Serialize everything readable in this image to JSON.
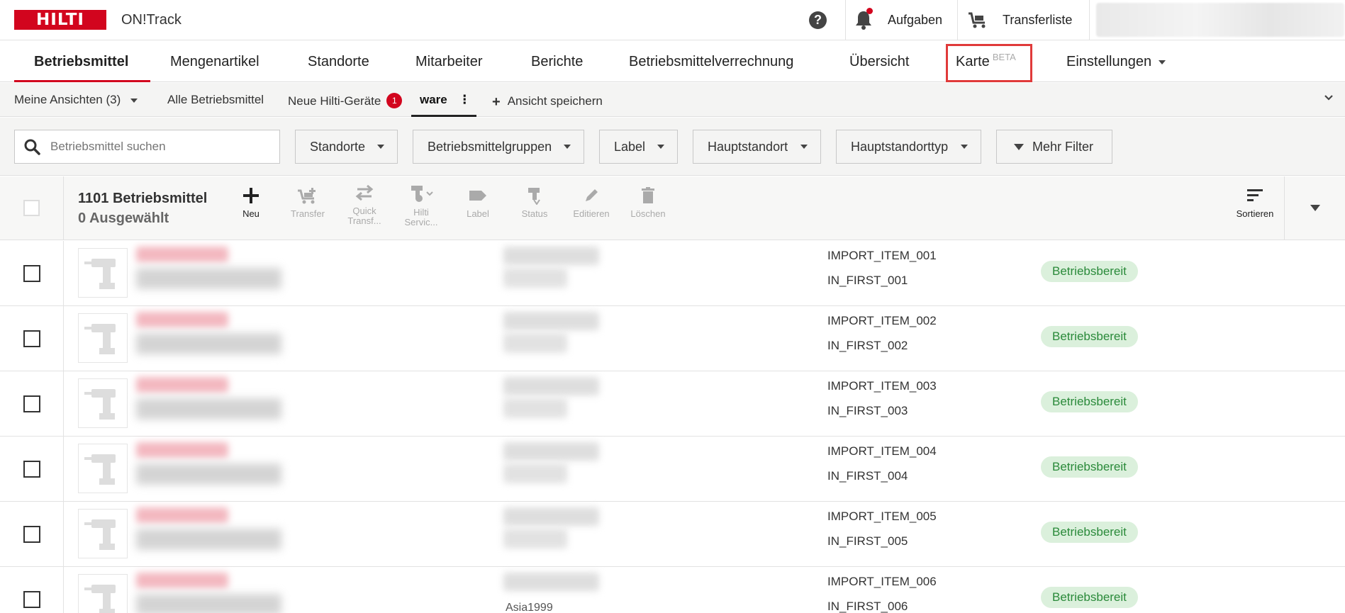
{
  "topbar": {
    "logo_text": "HILTI",
    "app_name": "ON!Track",
    "tasks_label": "Aufgaben",
    "transfer_label": "Transferliste"
  },
  "nav": {
    "items": [
      {
        "label": "Betriebsmittel"
      },
      {
        "label": "Mengenartikel"
      },
      {
        "label": "Standorte"
      },
      {
        "label": "Mitarbeiter"
      },
      {
        "label": "Berichte"
      },
      {
        "label": "Betriebsmittelverrechnung"
      },
      {
        "label": "Übersicht"
      },
      {
        "label": "Karte",
        "badge": "BETA"
      },
      {
        "label": "Einstellungen"
      }
    ]
  },
  "views": {
    "my_views": "Meine Ansichten (3)",
    "all": "Alle Betriebsmittel",
    "new_hilti": "Neue Hilti-Geräte",
    "new_hilti_count": "1",
    "current": "ware",
    "save_view": "Ansicht speichern"
  },
  "filters": {
    "search_placeholder": "Betriebsmittel suchen",
    "buttons": [
      "Standorte",
      "Betriebsmittelgruppen",
      "Label",
      "Hauptstandort",
      "Hauptstandorttyp"
    ],
    "more": "Mehr Filter"
  },
  "toolbar": {
    "count": "1101 Betriebsmittel",
    "selected": "0 Ausgewählt",
    "tools": {
      "new": "Neu",
      "transfer": "Transfer",
      "quick1": "Quick",
      "quick2": "Transf...",
      "hilti1": "Hilti",
      "hilti2": "Servic...",
      "label": "Label",
      "status": "Status",
      "edit": "Editieren",
      "delete": "Löschen",
      "sort": "Sortieren"
    }
  },
  "rows": [
    {
      "code": "IMPORT_ITEM_001",
      "inv": "IN_FIRST_001",
      "status": "Betriebsbereit"
    },
    {
      "code": "IMPORT_ITEM_002",
      "inv": "IN_FIRST_002",
      "status": "Betriebsbereit"
    },
    {
      "code": "IMPORT_ITEM_003",
      "inv": "IN_FIRST_003",
      "status": "Betriebsbereit"
    },
    {
      "code": "IMPORT_ITEM_004",
      "inv": "IN_FIRST_004",
      "status": "Betriebsbereit"
    },
    {
      "code": "IMPORT_ITEM_005",
      "inv": "IN_FIRST_005",
      "status": "Betriebsbereit"
    },
    {
      "code": "IMPORT_ITEM_006",
      "inv": "IN_FIRST_006",
      "status": "Betriebsbereit",
      "extra": "Asia1999"
    }
  ],
  "colors": {
    "brand": "#d2051e",
    "status_bg": "#dbf0dc",
    "status_text": "#2a8a3a"
  }
}
